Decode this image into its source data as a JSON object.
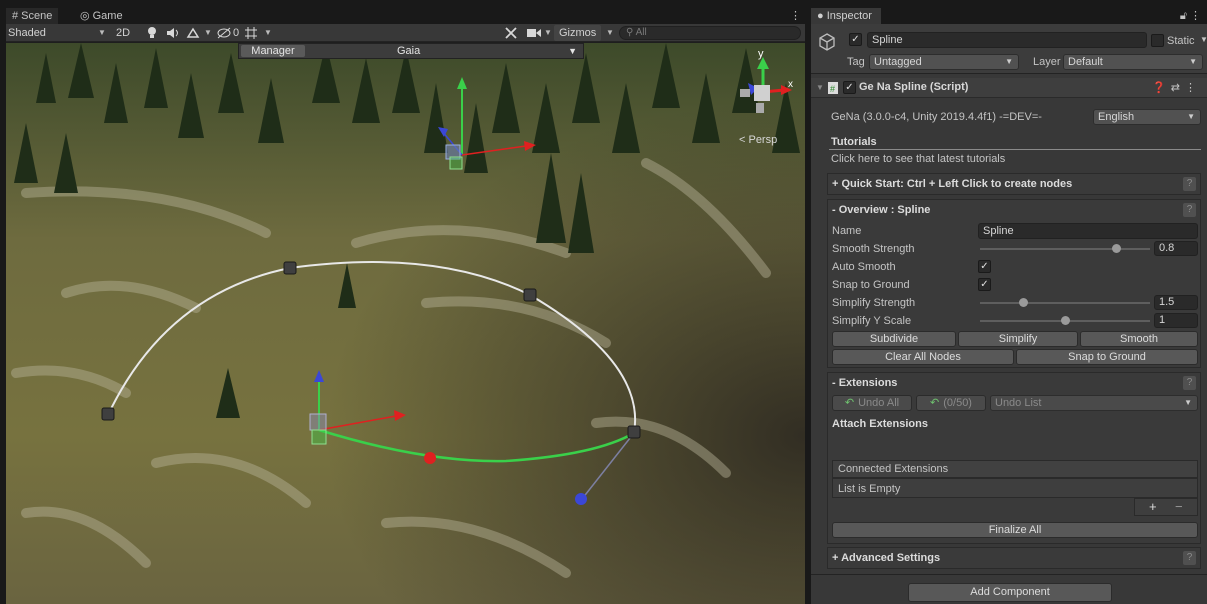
{
  "scene": {
    "tabs": [
      {
        "glyph": "#",
        "label": "Scene"
      },
      {
        "glyph": "◎",
        "label": "Game"
      }
    ],
    "menu_glyph": "⋮",
    "toolbar": {
      "shading_mode": "Shaded",
      "view_2d": "2D",
      "gizmos": "Gizmos",
      "search_placeholder": "All",
      "hidden_count": "0"
    },
    "manager_bar": {
      "manager_button": "Manager",
      "profile": "Gaia"
    },
    "persp_label": "< Persp",
    "axis_labels": {
      "y": "y",
      "x": "x"
    }
  },
  "inspector": {
    "tab_label": "Inspector",
    "game_object": {
      "active": true,
      "name": "Spline",
      "static_label": "Static",
      "tag_label": "Tag",
      "tag_value": "Untagged",
      "layer_label": "Layer",
      "layer_value": "Default"
    },
    "component": {
      "enabled": true,
      "title": "Ge Na Spline (Script)",
      "version_text": "GeNa (3.0.0-c4, Unity 2019.4.4f1) -=DEV=-",
      "language": "English",
      "tutorials_title": "Tutorials",
      "tutorials_link": "Click here to see that latest tutorials",
      "quick_start": "+ Quick Start: Ctrl + Left Click to create nodes",
      "overview": {
        "title": "- Overview : Spline",
        "name_label": "Name",
        "name_value": "Spline",
        "smooth_strength_label": "Smooth Strength",
        "smooth_strength_value": "0.8",
        "smooth_strength_fraction": 0.8,
        "auto_smooth_label": "Auto Smooth",
        "auto_smooth": true,
        "snap_to_ground_label": "Snap to Ground",
        "snap_to_ground": true,
        "simplify_strength_label": "Simplify Strength",
        "simplify_strength_value": "1.5",
        "simplify_strength_fraction": 0.25,
        "simplify_y_scale_label": "Simplify Y Scale",
        "simplify_y_scale_value": "1",
        "simplify_y_scale_fraction": 0.5,
        "buttons_row1": [
          "Subdivide",
          "Simplify",
          "Smooth"
        ],
        "buttons_row2": [
          "Clear All Nodes",
          "Snap to Ground"
        ]
      },
      "extensions": {
        "title": "- Extensions",
        "undo_all": "Undo All",
        "undo_count": "(0/50)",
        "undo_list": "Undo List",
        "attach_title": "Attach Extensions",
        "connected_title": "Connected Extensions",
        "list_empty": "List is Empty",
        "add_glyph": "+",
        "remove_glyph": "−",
        "finalize_all": "Finalize All"
      },
      "advanced_settings": "+ Advanced Settings",
      "help_glyph": "?"
    },
    "add_component": "Add Component"
  }
}
